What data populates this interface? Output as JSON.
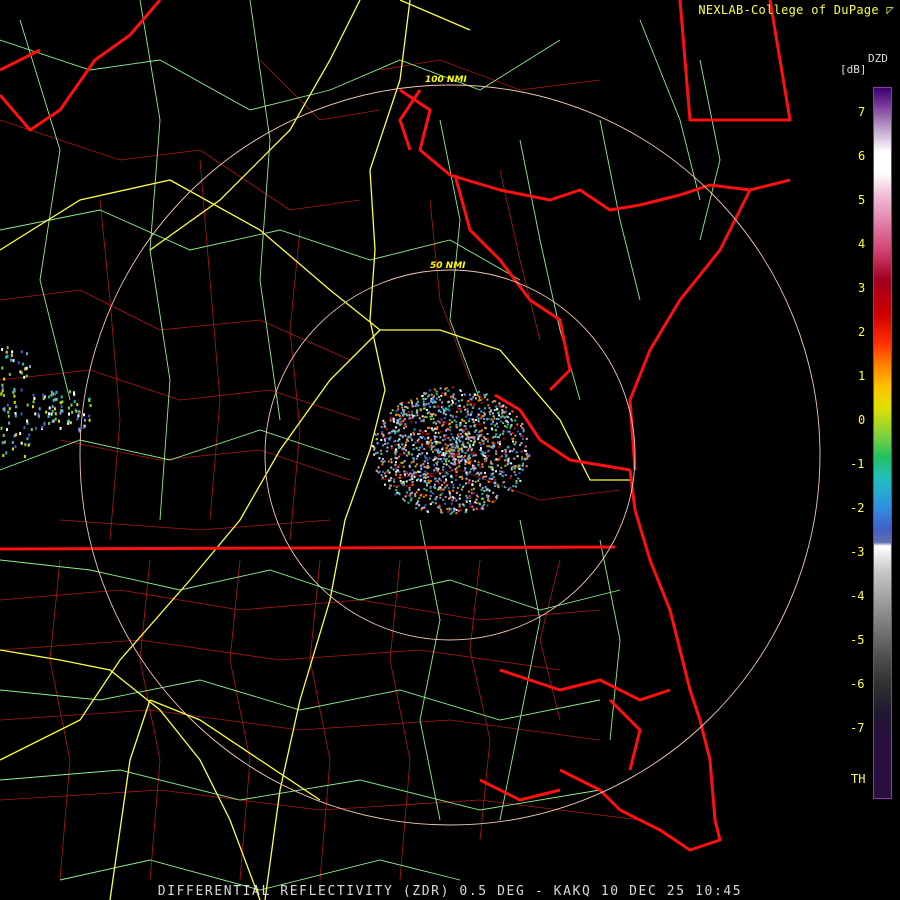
{
  "header": {
    "credit": "NEXLAB-College of DuPage"
  },
  "footer": {
    "product_line": "DIFFERENTIAL REFLECTIVITY (ZDR) 0.5 DEG - KAKQ 10 DEC 25 10:45"
  },
  "range_rings": [
    {
      "label": "100 NMI",
      "range_nmi": 100
    },
    {
      "label": "50 NMI",
      "range_nmi": 50
    }
  ],
  "legend": {
    "product_code": "DZD",
    "unit": "[dB]",
    "ticks": [
      "7",
      "6",
      "5",
      "4",
      "3",
      "2",
      "1",
      "0",
      "-1",
      "-2",
      "-3",
      "-4",
      "-5",
      "-6",
      "-7"
    ],
    "threshold_label": "TH",
    "colors": {
      "high": "#3a0070",
      "white": "#ffffff",
      "pink": "#e080a8",
      "red": "#d00000",
      "orange": "#ff8000",
      "yellow": "#e0e000",
      "green": "#20c060",
      "cyan": "#20c0c0",
      "blue": "#4060c8",
      "gray": "#a0a0a0",
      "low": "#2a1040"
    }
  },
  "map_colors": {
    "state_border": "#ff1010",
    "county_line": "#b01818",
    "highway": "#ffff40",
    "road": "#90ee90",
    "range_ring": "#f0c8b0"
  }
}
